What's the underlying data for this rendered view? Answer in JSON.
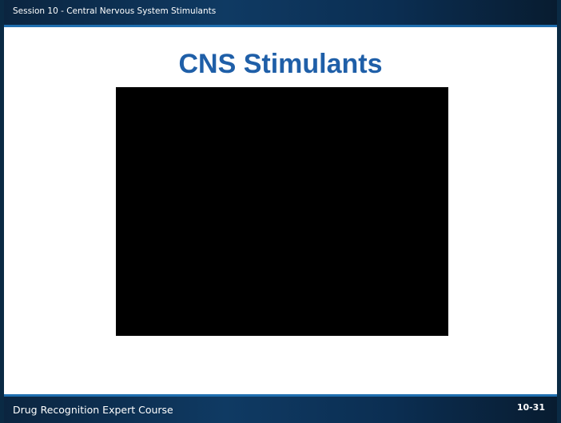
{
  "header": {
    "session_label": "Session 10 - Central Nervous System Stimulants"
  },
  "main": {
    "title": "CNS Stimulants"
  },
  "footer": {
    "course_label": "Drug Recognition Expert Course",
    "slide_number": "10-31"
  },
  "colors": {
    "title": "#1f5fa8",
    "bar": "#0b2540",
    "bar_accent": "#1f6fb0",
    "media_background": "#000000"
  }
}
